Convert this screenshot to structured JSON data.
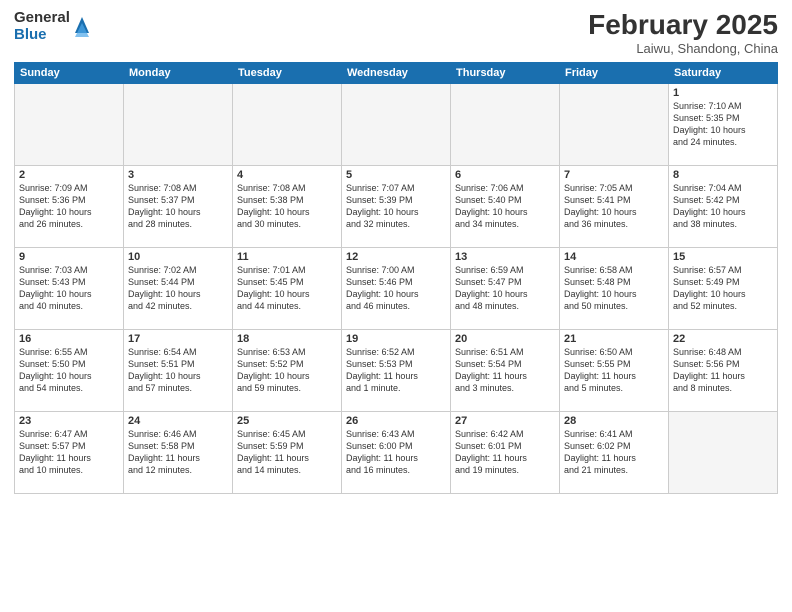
{
  "header": {
    "logo_general": "General",
    "logo_blue": "Blue",
    "month_title": "February 2025",
    "location": "Laiwu, Shandong, China"
  },
  "weekdays": [
    "Sunday",
    "Monday",
    "Tuesday",
    "Wednesday",
    "Thursday",
    "Friday",
    "Saturday"
  ],
  "weeks": [
    [
      {
        "day": "",
        "info": ""
      },
      {
        "day": "",
        "info": ""
      },
      {
        "day": "",
        "info": ""
      },
      {
        "day": "",
        "info": ""
      },
      {
        "day": "",
        "info": ""
      },
      {
        "day": "",
        "info": ""
      },
      {
        "day": "1",
        "info": "Sunrise: 7:10 AM\nSunset: 5:35 PM\nDaylight: 10 hours\nand 24 minutes."
      }
    ],
    [
      {
        "day": "2",
        "info": "Sunrise: 7:09 AM\nSunset: 5:36 PM\nDaylight: 10 hours\nand 26 minutes."
      },
      {
        "day": "3",
        "info": "Sunrise: 7:08 AM\nSunset: 5:37 PM\nDaylight: 10 hours\nand 28 minutes."
      },
      {
        "day": "4",
        "info": "Sunrise: 7:08 AM\nSunset: 5:38 PM\nDaylight: 10 hours\nand 30 minutes."
      },
      {
        "day": "5",
        "info": "Sunrise: 7:07 AM\nSunset: 5:39 PM\nDaylight: 10 hours\nand 32 minutes."
      },
      {
        "day": "6",
        "info": "Sunrise: 7:06 AM\nSunset: 5:40 PM\nDaylight: 10 hours\nand 34 minutes."
      },
      {
        "day": "7",
        "info": "Sunrise: 7:05 AM\nSunset: 5:41 PM\nDaylight: 10 hours\nand 36 minutes."
      },
      {
        "day": "8",
        "info": "Sunrise: 7:04 AM\nSunset: 5:42 PM\nDaylight: 10 hours\nand 38 minutes."
      }
    ],
    [
      {
        "day": "9",
        "info": "Sunrise: 7:03 AM\nSunset: 5:43 PM\nDaylight: 10 hours\nand 40 minutes."
      },
      {
        "day": "10",
        "info": "Sunrise: 7:02 AM\nSunset: 5:44 PM\nDaylight: 10 hours\nand 42 minutes."
      },
      {
        "day": "11",
        "info": "Sunrise: 7:01 AM\nSunset: 5:45 PM\nDaylight: 10 hours\nand 44 minutes."
      },
      {
        "day": "12",
        "info": "Sunrise: 7:00 AM\nSunset: 5:46 PM\nDaylight: 10 hours\nand 46 minutes."
      },
      {
        "day": "13",
        "info": "Sunrise: 6:59 AM\nSunset: 5:47 PM\nDaylight: 10 hours\nand 48 minutes."
      },
      {
        "day": "14",
        "info": "Sunrise: 6:58 AM\nSunset: 5:48 PM\nDaylight: 10 hours\nand 50 minutes."
      },
      {
        "day": "15",
        "info": "Sunrise: 6:57 AM\nSunset: 5:49 PM\nDaylight: 10 hours\nand 52 minutes."
      }
    ],
    [
      {
        "day": "16",
        "info": "Sunrise: 6:55 AM\nSunset: 5:50 PM\nDaylight: 10 hours\nand 54 minutes."
      },
      {
        "day": "17",
        "info": "Sunrise: 6:54 AM\nSunset: 5:51 PM\nDaylight: 10 hours\nand 57 minutes."
      },
      {
        "day": "18",
        "info": "Sunrise: 6:53 AM\nSunset: 5:52 PM\nDaylight: 10 hours\nand 59 minutes."
      },
      {
        "day": "19",
        "info": "Sunrise: 6:52 AM\nSunset: 5:53 PM\nDaylight: 11 hours\nand 1 minute."
      },
      {
        "day": "20",
        "info": "Sunrise: 6:51 AM\nSunset: 5:54 PM\nDaylight: 11 hours\nand 3 minutes."
      },
      {
        "day": "21",
        "info": "Sunrise: 6:50 AM\nSunset: 5:55 PM\nDaylight: 11 hours\nand 5 minutes."
      },
      {
        "day": "22",
        "info": "Sunrise: 6:48 AM\nSunset: 5:56 PM\nDaylight: 11 hours\nand 8 minutes."
      }
    ],
    [
      {
        "day": "23",
        "info": "Sunrise: 6:47 AM\nSunset: 5:57 PM\nDaylight: 11 hours\nand 10 minutes."
      },
      {
        "day": "24",
        "info": "Sunrise: 6:46 AM\nSunset: 5:58 PM\nDaylight: 11 hours\nand 12 minutes."
      },
      {
        "day": "25",
        "info": "Sunrise: 6:45 AM\nSunset: 5:59 PM\nDaylight: 11 hours\nand 14 minutes."
      },
      {
        "day": "26",
        "info": "Sunrise: 6:43 AM\nSunset: 6:00 PM\nDaylight: 11 hours\nand 16 minutes."
      },
      {
        "day": "27",
        "info": "Sunrise: 6:42 AM\nSunset: 6:01 PM\nDaylight: 11 hours\nand 19 minutes."
      },
      {
        "day": "28",
        "info": "Sunrise: 6:41 AM\nSunset: 6:02 PM\nDaylight: 11 hours\nand 21 minutes."
      },
      {
        "day": "",
        "info": ""
      }
    ]
  ]
}
